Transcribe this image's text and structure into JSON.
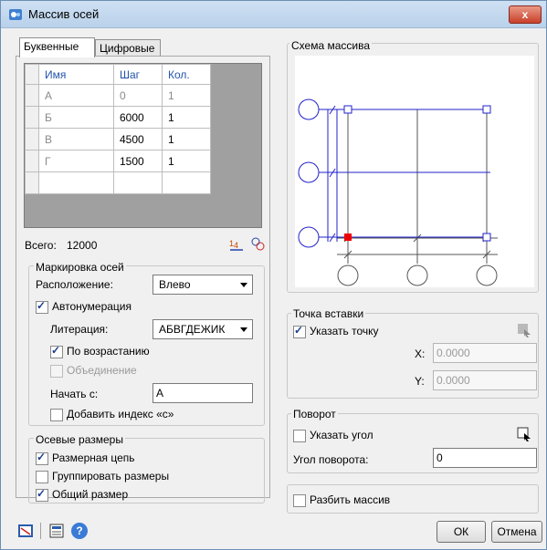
{
  "window": {
    "title": "Массив осей",
    "close_label": "x"
  },
  "tabs": [
    {
      "label": "Буквенные"
    },
    {
      "label": "Цифровые"
    }
  ],
  "grid": {
    "columns": [
      "Имя",
      "Шаг",
      "Кол."
    ],
    "rows": [
      {
        "name": "А",
        "step": "0",
        "count": "1"
      },
      {
        "name": "Б",
        "step": "6000",
        "count": "1"
      },
      {
        "name": "В",
        "step": "4500",
        "count": "1"
      },
      {
        "name": "Г",
        "step": "1500",
        "count": "1"
      },
      {
        "name": "",
        "step": "",
        "count": ""
      }
    ]
  },
  "total": {
    "label": "Всего:",
    "value": "12000"
  },
  "marking": {
    "title": "Маркировка осей",
    "placement_label": "Расположение:",
    "placement_value": "Влево",
    "autonum_label": "Автонумерация",
    "literation_label": "Литерация:",
    "literation_value": "АБВГДЕЖИК",
    "ascending_label": "По возрастанию",
    "merge_label": "Объединение",
    "start_label": "Начать с:",
    "start_value": "А",
    "add_index_label": "Добавить индекс «с»"
  },
  "dims": {
    "title": "Осевые размеры",
    "chain_label": "Размерная цепь",
    "group_label": "Группировать размеры",
    "overall_label": "Общий размер"
  },
  "scheme": {
    "title": "Схема массива"
  },
  "insert_point": {
    "title": "Точка вставки",
    "specify_label": "Указать точку",
    "x_label": "X:",
    "x_value": "0.0000",
    "y_label": "Y:",
    "y_value": "0.0000"
  },
  "rotation": {
    "title": "Поворот",
    "specify_label": "Указать угол",
    "angle_label": "Угол поворота:",
    "angle_value": "0"
  },
  "explode": {
    "label": "Разбить массив"
  },
  "footer": {
    "ok_label": "ОК",
    "cancel_label": "Отмена",
    "help_glyph": "?"
  },
  "colors": {
    "accent": "#2255aa",
    "axis_line": "#2222cc",
    "marker_red": "#ee0000"
  }
}
